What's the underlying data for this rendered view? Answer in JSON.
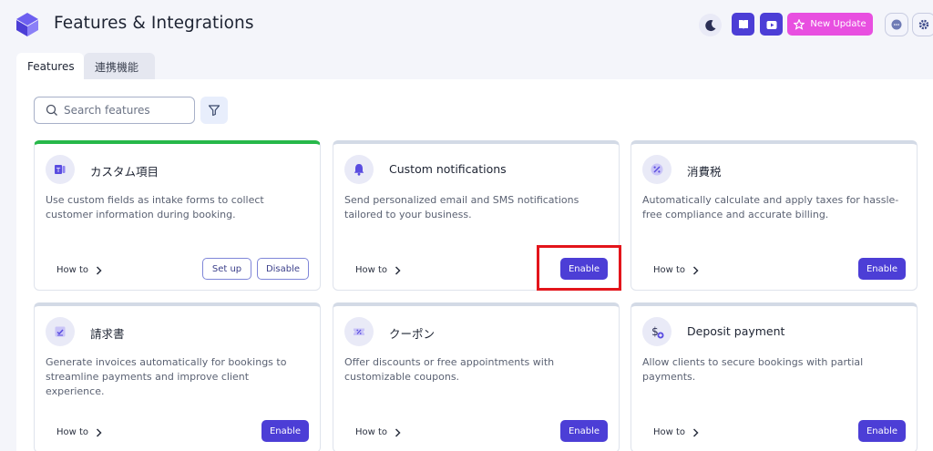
{
  "header": {
    "title": "Features & Integrations",
    "new_update_label": "New Update",
    "accent": "#4c3ed6",
    "update_color": "#e84fe0"
  },
  "tabs": [
    {
      "label": "Features",
      "active": true
    },
    {
      "label": "連携機能",
      "active": false
    }
  ],
  "search": {
    "placeholder": "Search features",
    "value": ""
  },
  "how_to_label": "How to",
  "cards": [
    {
      "icon": "custom-fields-icon",
      "title": "カスタム項目",
      "description": "Use custom fields as intake forms to collect customer information during booking.",
      "enabled": true,
      "setup_label": "Set up",
      "disable_label": "Disable"
    },
    {
      "icon": "bell-icon",
      "title": "Custom notifications",
      "description": "Send personalized email and SMS notifications tailored to your business.",
      "enabled": false,
      "enable_label": "Enable",
      "highlighted": true
    },
    {
      "icon": "percent-icon",
      "title": "消費税",
      "description": "Automatically calculate and apply taxes for hassle-free compliance and accurate billing.",
      "enabled": false,
      "enable_label": "Enable"
    },
    {
      "icon": "invoice-icon",
      "title": "請求書",
      "description": "Generate invoices automatically for bookings to streamline payments and improve client experience.",
      "enabled": false,
      "enable_label": "Enable"
    },
    {
      "icon": "coupon-icon",
      "title": "クーポン",
      "description": "Offer discounts or free appointments with customizable coupons.",
      "enabled": false,
      "enable_label": "Enable"
    },
    {
      "icon": "deposit-icon",
      "title": "Deposit payment",
      "description": "Allow clients to secure bookings with partial payments.",
      "enabled": false,
      "enable_label": "Enable"
    }
  ]
}
